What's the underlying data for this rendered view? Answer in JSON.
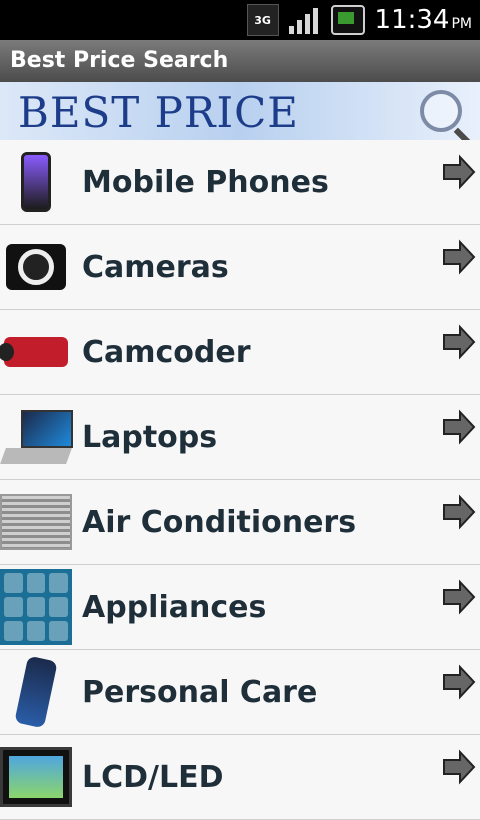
{
  "status_bar": {
    "network": "3G",
    "time": "11:34",
    "ampm": "PM"
  },
  "app": {
    "title": "Best Price Search",
    "banner_text": "BEST PRICE SEARCH"
  },
  "categories": [
    {
      "label": "Mobile Phones",
      "icon": "mobile-phone-icon"
    },
    {
      "label": "Cameras",
      "icon": "camera-icon"
    },
    {
      "label": "Camcoder",
      "icon": "camcorder-icon"
    },
    {
      "label": "Laptops",
      "icon": "laptop-icon"
    },
    {
      "label": "Air Conditioners",
      "icon": "air-conditioner-icon"
    },
    {
      "label": "Appliances",
      "icon": "appliances-icon"
    },
    {
      "label": "Personal Care",
      "icon": "shaver-icon"
    },
    {
      "label": "LCD/LED",
      "icon": "tv-icon"
    }
  ],
  "colors": {
    "title_bar": "#5f5f5f",
    "label_text": "#1f2f3a",
    "banner_text": "#1d3d8a"
  }
}
